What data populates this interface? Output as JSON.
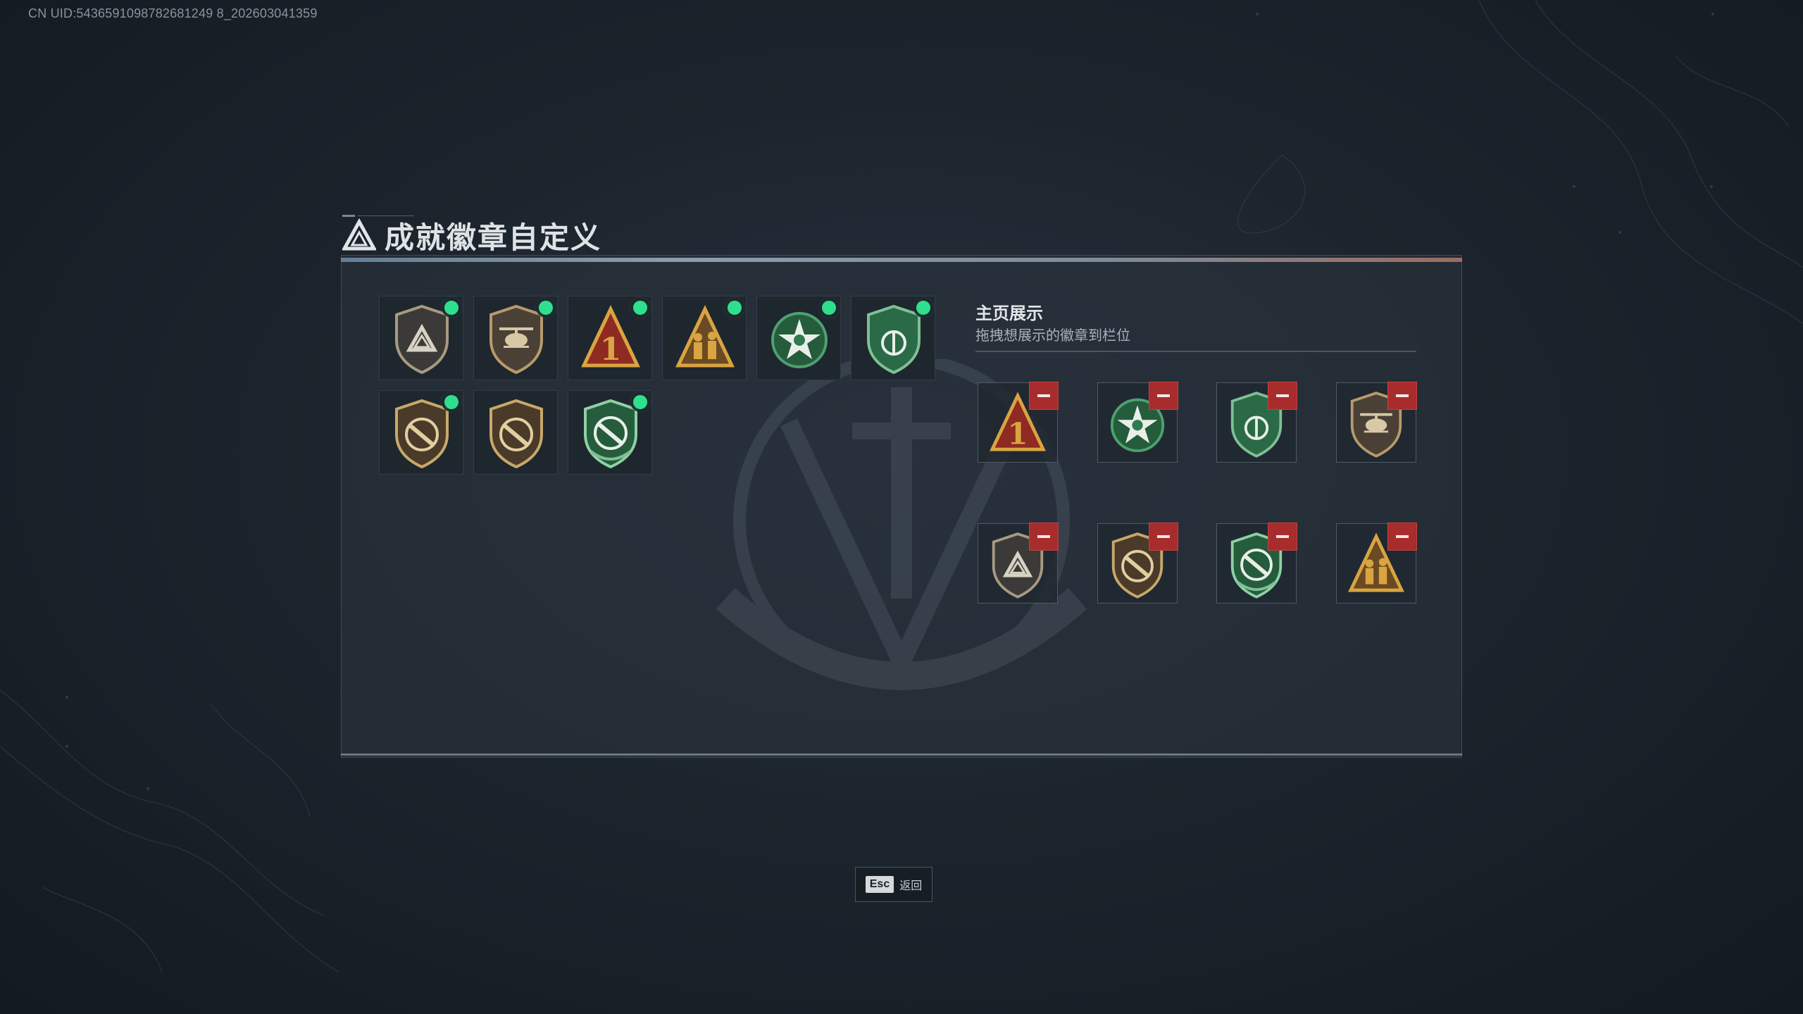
{
  "uid_text": "CN UID:5436591098782681249 8_202603041359",
  "title": "成就徽章自定义",
  "colors": {
    "accent_new": "#2ee08e",
    "remove": "#a82c2c",
    "bronze": "#b89a6a",
    "green": "#2f7a4e",
    "red": "#8e2a22",
    "gold": "#d9a441"
  },
  "owned_badges": [
    {
      "icon": "shield-triangle-badge-icon",
      "new": true
    },
    {
      "icon": "shield-helicopter-badge-icon",
      "new": true
    },
    {
      "icon": "triangle-number-one-badge-icon",
      "new": true
    },
    {
      "icon": "triangle-soldiers-badge-icon",
      "new": true
    },
    {
      "icon": "green-star-wreath-badge-icon",
      "new": true
    },
    {
      "icon": "green-shield-emblem-badge-icon",
      "new": true
    },
    {
      "icon": "shield-rifle-badge-icon",
      "new": true
    },
    {
      "icon": "shield-rifle-badge-icon",
      "new": false
    },
    {
      "icon": "green-shield-rifle-badge-icon",
      "new": true
    }
  ],
  "display": {
    "title": "主页展示",
    "subtitle": "拖拽想展示的徽章到栏位",
    "slots": [
      {
        "icon": "triangle-number-one-badge-icon"
      },
      {
        "icon": "green-star-wreath-badge-icon"
      },
      {
        "icon": "green-shield-emblem-badge-icon"
      },
      {
        "icon": "shield-helicopter-badge-icon"
      },
      {
        "icon": "shield-triangle-badge-icon"
      },
      {
        "icon": "shield-rifle-badge-icon"
      },
      {
        "icon": "green-shield-rifle-badge-icon"
      },
      {
        "icon": "triangle-soldiers-badge-icon"
      }
    ]
  },
  "footer": {
    "key": "Esc",
    "label": "返回"
  }
}
